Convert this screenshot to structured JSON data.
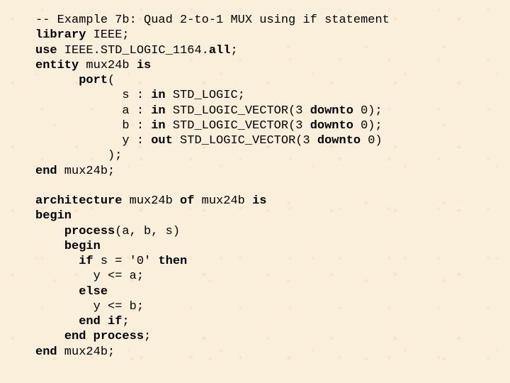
{
  "code": {
    "c01": "-- Example 7b: Quad 2-to-1 MUX using if statement",
    "c02a": "library",
    "c02b": " IEEE;",
    "c03a": "use",
    "c03b": " IEEE.STD_LOGIC_1164.",
    "c03c": "all",
    "c03d": ";",
    "c04a": "entity",
    "c04b": " mux24b ",
    "c04c": "is",
    "c05a": "port",
    "c05b": "(",
    "c06a": "s : ",
    "c06b": "in",
    "c06c": " STD_LOGIC;",
    "c07a": "a : ",
    "c07b": "in",
    "c07c": " STD_LOGIC_VECTOR(3 ",
    "c07d": "downto",
    "c07e": " 0);",
    "c08a": "b : ",
    "c08b": "in",
    "c08c": " STD_LOGIC_VECTOR(3 ",
    "c08d": "downto",
    "c08e": " 0);",
    "c09a": "y : ",
    "c09b": "out",
    "c09c": " STD_LOGIC_VECTOR(3 ",
    "c09d": "downto",
    "c09e": " 0)",
    "c10": ");",
    "c11a": "end",
    "c11b": " mux24b;",
    "blank": " ",
    "c13a": "architecture",
    "c13b": " mux24b ",
    "c13c": "of",
    "c13d": " mux24b ",
    "c13e": "is",
    "c14": "begin",
    "c15a": "process",
    "c15b": "(a, b, s)",
    "c16": "begin",
    "c17a": "if",
    "c17b": " s = '0' ",
    "c17c": "then",
    "c18": "y <= a;",
    "c19": "else",
    "c20": "y <= b;",
    "c21a": "end",
    "c21b": " ",
    "c21c": "if",
    "c21d": ";",
    "c22a": "end",
    "c22b": " ",
    "c22c": "process",
    "c22d": ";",
    "c23a": "end",
    "c23b": " mux24b;"
  },
  "indent": {
    "i0": "",
    "i6": "      ",
    "i10": "          ",
    "i12": "            ",
    "i4": "    ",
    "i8": "        ",
    "i11": "           "
  }
}
